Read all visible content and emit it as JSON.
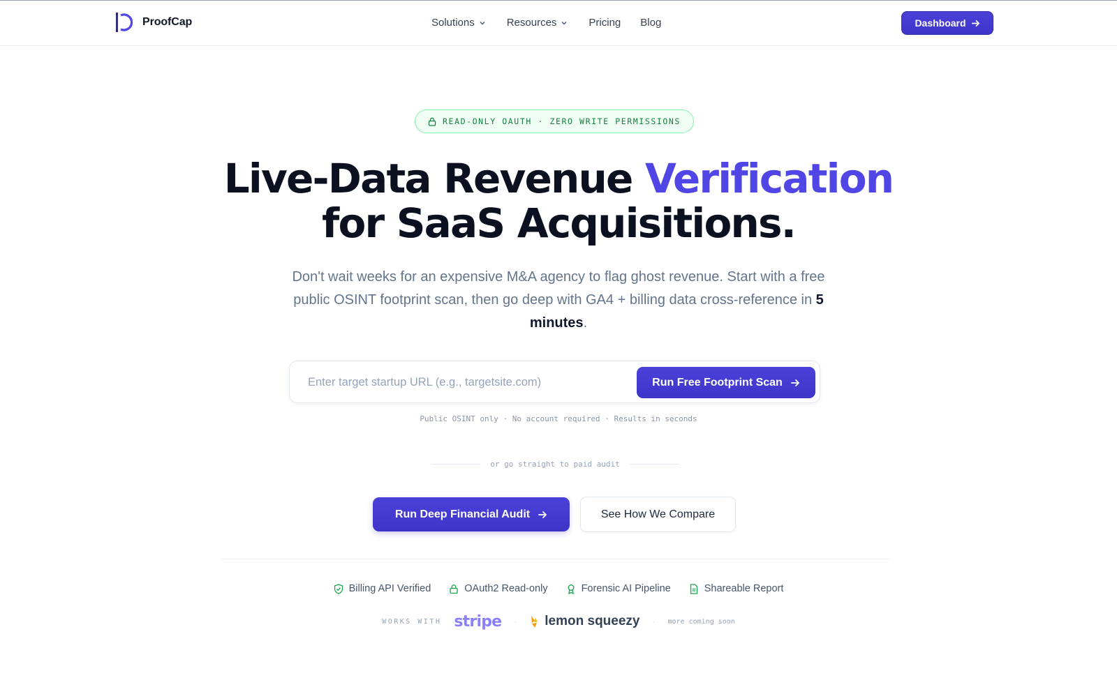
{
  "brand": {
    "name": "ProofCap"
  },
  "nav": {
    "items": [
      {
        "label": "Solutions",
        "has_dropdown": true
      },
      {
        "label": "Resources",
        "has_dropdown": true
      },
      {
        "label": "Pricing",
        "has_dropdown": false
      },
      {
        "label": "Blog",
        "has_dropdown": false
      }
    ],
    "dashboard_label": "Dashboard"
  },
  "hero": {
    "badge": "READ-ONLY OAUTH · ZERO WRITE PERMISSIONS",
    "headline_part1": "Live-Data Revenue ",
    "headline_accent": "Verification",
    "headline_part2": "for SaaS Acquisitions.",
    "sub_text": "Don't wait weeks for an expensive M&A agency to flag ghost revenue. Start with a free public OSINT footprint scan, then go deep with GA4 + billing data cross-reference in ",
    "sub_strong": "5 minutes",
    "sub_end": "."
  },
  "search": {
    "placeholder": "Enter target startup URL (e.g., targetsite.com)",
    "value": "",
    "button_label": "Run Free Footprint Scan"
  },
  "note": "Public OSINT only · No account required · Results in seconds",
  "divider_text": "or go straight to paid audit",
  "cta": {
    "primary_label": "Run Deep Financial Audit",
    "secondary_label": "See How We Compare"
  },
  "features": [
    {
      "label": "Billing API Verified",
      "icon": "shield-check-icon"
    },
    {
      "label": "OAuth2 Read-only",
      "icon": "lock-icon"
    },
    {
      "label": "Forensic AI Pipeline",
      "icon": "award-icon"
    },
    {
      "label": "Shareable Report",
      "icon": "document-icon"
    }
  ],
  "works_with": {
    "label": "WORKS WITH",
    "stripe": "stripe",
    "lemon": "lemon squeezy",
    "soon": "more coming soon"
  },
  "colors": {
    "accent": "#4f46e5",
    "success": "#16a34a",
    "stripe": "#8b80f9"
  }
}
